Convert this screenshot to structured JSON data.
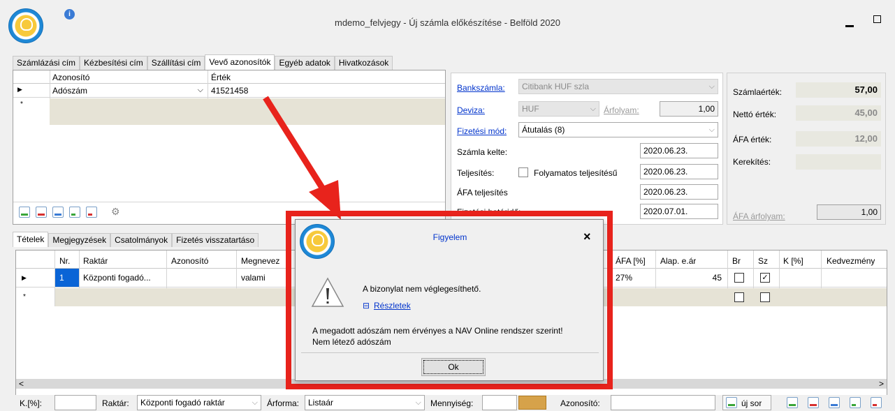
{
  "window": {
    "title": "mdemo_felvjegy - Új számla előkészítése - Belföld 2020",
    "info_glyph": "i"
  },
  "top_tabs": [
    {
      "label": "Számlázási cím"
    },
    {
      "label": "Kézbesítési cím"
    },
    {
      "label": "Szállítási cím"
    },
    {
      "label": "Vevő azonosítók",
      "active": true
    },
    {
      "label": "Egyéb adatok"
    },
    {
      "label": "Hivatkozások"
    }
  ],
  "id_grid": {
    "headers": [
      "Azonosító",
      "Érték"
    ],
    "row": {
      "azonosito": "Adószám",
      "ertek": "41521458"
    },
    "new_row_marker": "*"
  },
  "form": {
    "bank_label": "Bankszámla:",
    "bank_value": "Citibank HUF szla",
    "deviza_label": "Deviza:",
    "deviza_value": "HUF",
    "arfolyam_label": "Árfolyam:",
    "arfolyam_value": "1,00",
    "fizetesi_label": "Fizetési mód:",
    "fizetesi_value": "Átutalás (8)",
    "kelte_label": "Számla kelte:",
    "kelte_value": "2020.06.23.",
    "teljesites_label": "Teljesítés:",
    "folyamatos_label": "Folyamatos teljesítésű",
    "teljesites_value": "2020.06.23.",
    "afa_telj_label": "ÁFA teljesítés",
    "afa_telj_value": "2020.06.23.",
    "hatarido_label": "Fizetési határidő:",
    "hatarido_value": "2020.07.01."
  },
  "summary": {
    "szamlaertek_label": "Számlaérték:",
    "szamlaertek": "57,00",
    "netto_label": "Nettó érték:",
    "netto": "45,00",
    "afa_label": "ÁFA érték:",
    "afa": "12,00",
    "kerekites_label": "Kerekítés:",
    "kerekites": "",
    "afa_arfolyam_label": "ÁFA árfolyam:",
    "afa_arfolyam": "1,00"
  },
  "bottom_tabs": [
    {
      "label": "Tételek",
      "active": true
    },
    {
      "label": "Megjegyzések"
    },
    {
      "label": "Csatolmányok"
    },
    {
      "label": "Fizetés visszatartáso"
    }
  ],
  "items_grid": {
    "headers": {
      "nr": "Nr.",
      "raktar": "Raktár",
      "azonosito": "Azonosító",
      "megnevezes": "Megnevez",
      "afa": "ÁFA [%]",
      "alap": "Alap. e.ár",
      "br": "Br",
      "sz": "Sz",
      "k": "K [%]",
      "kedv": "Kedvezmény"
    },
    "row": {
      "nr": "1",
      "raktar": "Központi fogadó...",
      "azonosito": "",
      "megnevezes": "valami",
      "afa": "27%",
      "alap": "45",
      "br": false,
      "sz": true
    }
  },
  "footer": {
    "k_label": "K.[%]:",
    "raktar_label": "Raktár:",
    "raktar_value": "Központi fogadó raktár",
    "arforma_label": "Árforma:",
    "arforma_value": "Listaár",
    "mennyiseg_label": "Mennyiség:",
    "azonosito_label": "Azonosító:",
    "uj_sor_label": "új sor"
  },
  "dialog": {
    "title": "Figyelem",
    "close": "×",
    "message": "A bizonylat nem véglegesíthető.",
    "details_toggle": "⊟",
    "details_label": "Részletek",
    "detail_line1": "A megadott adószám nem érvényes a NAV Online rendszer szerint!",
    "detail_line2": "Nem létező adószám",
    "ok": "Ok"
  },
  "colors": {
    "annotation_red": "#e8231c",
    "link": "#0033cc",
    "selection": "#0a64d6"
  }
}
